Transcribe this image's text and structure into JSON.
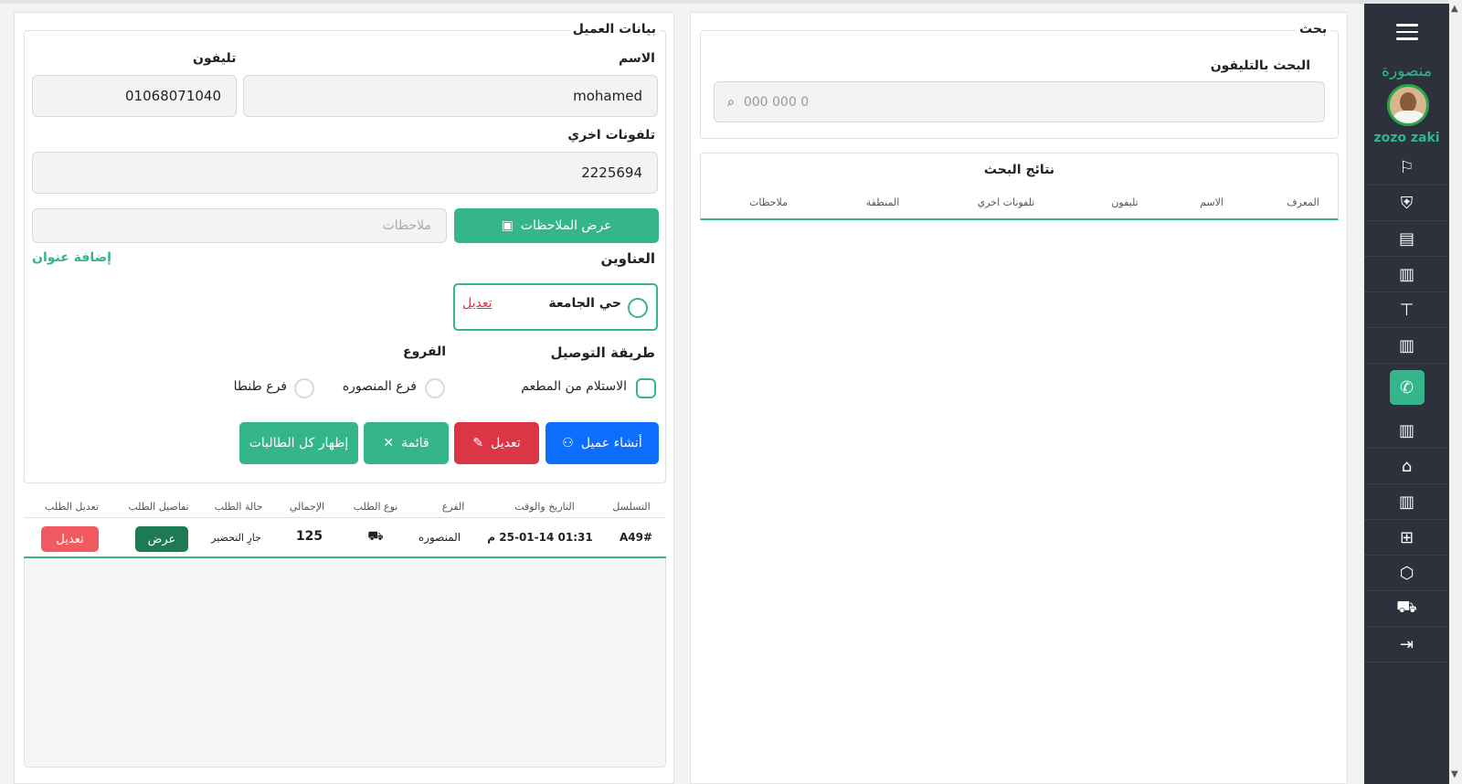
{
  "sidebar": {
    "brand": "منصورة",
    "user": "zozo zaki",
    "items": [
      {
        "icon": "signpost-icon",
        "glyph": "⚐"
      },
      {
        "icon": "shield-icon",
        "glyph": "⛨"
      },
      {
        "icon": "cash-register-icon",
        "glyph": "▤"
      },
      {
        "icon": "receipt-icon",
        "glyph": "▥"
      },
      {
        "icon": "table-icon",
        "glyph": "⊤"
      },
      {
        "icon": "receipt-icon",
        "glyph": "▥"
      },
      {
        "icon": "phone-icon",
        "glyph": "✆"
      },
      {
        "icon": "receipt-icon",
        "glyph": "▥"
      },
      {
        "icon": "home-icon",
        "glyph": "⌂"
      },
      {
        "icon": "receipt-icon",
        "glyph": "▥"
      },
      {
        "icon": "gift-icon",
        "glyph": "⊞"
      },
      {
        "icon": "box-icon",
        "glyph": "⬡"
      },
      {
        "icon": "delivery-icon",
        "glyph": "⛟"
      },
      {
        "icon": "logout-icon",
        "glyph": "⇥"
      }
    ]
  },
  "search": {
    "legend": "بحث",
    "phone_label": "البحث بالتليفون",
    "placeholder": "000 000 0",
    "results_title": "نتائج البحث",
    "columns": [
      "المعرف",
      "الاسم",
      "تليفون",
      "تلفونات اخري",
      "المنطقة",
      "ملاحظات"
    ]
  },
  "customer": {
    "legend": "بيانات العميل",
    "name_label": "الاسم",
    "name_value": "mohamed",
    "phone_label": "تليفون",
    "phone_value": "01068071040",
    "other_phones_label": "تلفونات اخري",
    "other_phones_value": "2225694",
    "notes_button": "عرض الملاحظات",
    "notes_placeholder": "ملاحظات",
    "addresses_label": "العناوين",
    "add_address": "إضافة عنوان",
    "address_name": "حي الجامعة",
    "address_edit": "تعديل",
    "delivery_label": "طريقة التوصيل",
    "pickup_option": "الاستلام من المطعم",
    "branches_label": "الفروع",
    "branch_1": "فرع المنصوره",
    "branch_2": "فرع طنطا",
    "create_button": "أنشاء عميل",
    "edit_button": "تعديل",
    "menu_button": "قائمة",
    "show_tables_button": "إظهار كل الطالبات"
  },
  "orders": {
    "columns": [
      "التسلسل",
      "التاريخ والوقت",
      "الفرع",
      "نوع الطلب",
      "الإجمالي",
      "حالة الطلب",
      "تفاصيل الطلب",
      "تعديل الطلب"
    ],
    "rows": [
      {
        "serial": "A49#",
        "datetime": "01:31 25-01-14 م",
        "branch": "المنصوره",
        "type_icon": "delivery-icon",
        "total": "125",
        "status": "جارِ التحضير",
        "view": "عرض",
        "edit": "تعديل"
      }
    ]
  },
  "colors": {
    "accent": "#35b58c",
    "primary": "#0d6efd",
    "danger": "#dc3545",
    "sidebar": "#2c313c"
  }
}
